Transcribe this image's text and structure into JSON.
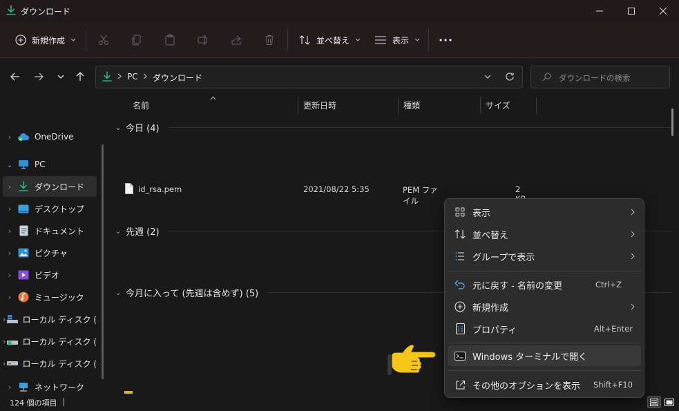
{
  "window": {
    "title": "ダウンロード",
    "minimize_label": "—",
    "maximize_label": "☐",
    "close_label": "✕"
  },
  "toolbar": {
    "new_label": "新規作成",
    "sort_label": "並べ替え",
    "view_label": "表示",
    "more_label": "•••"
  },
  "address": {
    "crumbs": [
      "PC",
      "ダウンロード"
    ],
    "search_placeholder": "ダウンロードの検索"
  },
  "sidebar": {
    "items": [
      {
        "label": "OneDrive"
      },
      {
        "label": "PC"
      },
      {
        "label": "ダウンロード"
      },
      {
        "label": "デスクトップ"
      },
      {
        "label": "ドキュメント"
      },
      {
        "label": "ピクチャ"
      },
      {
        "label": "ビデオ"
      },
      {
        "label": "ミュージック"
      },
      {
        "label": "ローカル ディスク ("
      },
      {
        "label": "ローカル ディスク ("
      },
      {
        "label": "ローカル ディスク ("
      },
      {
        "label": "ネットワーク"
      }
    ]
  },
  "columns": {
    "name": "名前",
    "date": "更新日時",
    "type": "種類",
    "size": "サイズ"
  },
  "groups": [
    {
      "label": "今日 (4)"
    },
    {
      "label": "先週 (2)"
    },
    {
      "label": "今月に入って (先週は含めず) (5)"
    }
  ],
  "file": {
    "name": "id_rsa.pem",
    "date": "2021/08/22 5:35",
    "type": "PEM ファイル",
    "size": "2 KB"
  },
  "status": {
    "count": "124 個の項目"
  },
  "context_menu": {
    "items": [
      {
        "label": "表示",
        "shortcut": ""
      },
      {
        "label": "並べ替え",
        "shortcut": ""
      },
      {
        "label": "グループで表示",
        "shortcut": ""
      },
      {
        "label": "元に戻す - 名前の変更",
        "shortcut": "Ctrl+Z"
      },
      {
        "label": "新規作成",
        "shortcut": ""
      },
      {
        "label": "プロパティ",
        "shortcut": "Alt+Enter"
      },
      {
        "label": "Windows ターミナルで開く",
        "shortcut": ""
      },
      {
        "label": "その他のオプションを表示",
        "shortcut": "Shift+F10"
      }
    ]
  },
  "colors": {
    "accent_green": "#2cb67d",
    "background": "#191919",
    "menu_bg": "#2c2c2c",
    "pointer_yellow": "#f5c518"
  }
}
